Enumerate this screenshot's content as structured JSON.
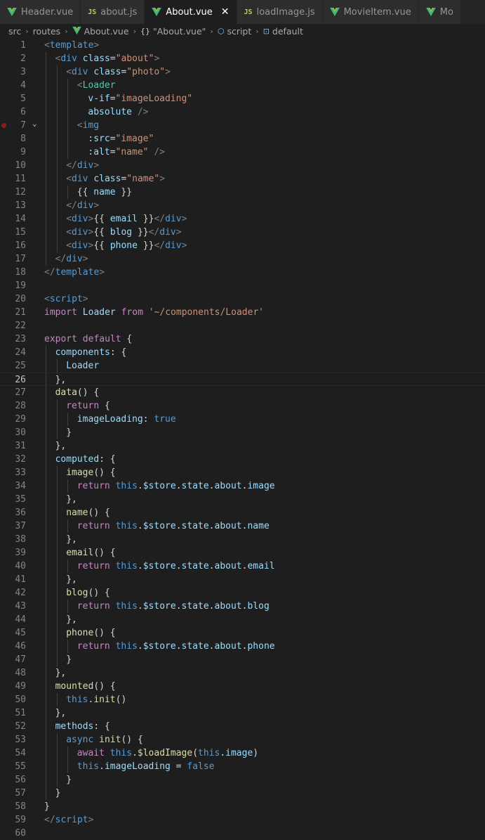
{
  "tabs": [
    {
      "label": "Header.vue",
      "icon": "vue-icon",
      "active": false
    },
    {
      "label": "about.js",
      "icon": "js-icon",
      "active": false
    },
    {
      "label": "About.vue",
      "icon": "vue-icon",
      "active": true
    },
    {
      "label": "loadImage.js",
      "icon": "js-icon",
      "active": false
    },
    {
      "label": "MovieItem.vue",
      "icon": "vue-icon",
      "active": false
    },
    {
      "label": "Mo",
      "icon": "vue-icon",
      "active": false
    }
  ],
  "tab_close_glyph": "✕",
  "breadcrumb": {
    "items": [
      "src",
      "routes",
      "About.vue",
      "\"About.vue\"",
      "script",
      "default"
    ],
    "icons": [
      "",
      "",
      "vue-icon",
      "braces-icon",
      "cube-icon",
      "symbol-icon"
    ],
    "braces_glyph": "{}",
    "separator": "›"
  },
  "editor": {
    "current_line": 26,
    "breakpoint_line": 7,
    "fold_line": 7,
    "lines": [
      {
        "n": "1",
        "indent": 0,
        "tokens": [
          [
            "<",
            "tg"
          ],
          [
            "template",
            "tn"
          ],
          [
            ">",
            "tg"
          ]
        ]
      },
      {
        "n": "2",
        "indent": 1,
        "tokens": [
          [
            "<",
            "tg"
          ],
          [
            "div",
            "tn"
          ],
          [
            " ",
            ""
          ],
          [
            "class",
            "at"
          ],
          [
            "=",
            "tx"
          ],
          [
            "\"about\"",
            "st"
          ],
          [
            ">",
            "tg"
          ]
        ]
      },
      {
        "n": "3",
        "indent": 2,
        "tokens": [
          [
            "<",
            "tg"
          ],
          [
            "div",
            "tn"
          ],
          [
            " ",
            ""
          ],
          [
            "class",
            "at"
          ],
          [
            "=",
            "tx"
          ],
          [
            "\"photo\"",
            "st"
          ],
          [
            ">",
            "tg"
          ]
        ]
      },
      {
        "n": "4",
        "indent": 3,
        "tokens": [
          [
            "<",
            "tg"
          ],
          [
            "Loader",
            "cm"
          ]
        ]
      },
      {
        "n": "5",
        "indent": 3,
        "extra": 1,
        "tokens": [
          [
            "v-if",
            "at"
          ],
          [
            "=",
            "tx"
          ],
          [
            "\"imageLoading\"",
            "st"
          ]
        ]
      },
      {
        "n": "6",
        "indent": 3,
        "extra": 1,
        "tokens": [
          [
            "absolute",
            "at"
          ],
          [
            " ",
            ""
          ],
          [
            "/>",
            "tg"
          ]
        ]
      },
      {
        "n": "7",
        "indent": 3,
        "tokens": [
          [
            "<",
            "tg"
          ],
          [
            "img",
            "tn"
          ]
        ]
      },
      {
        "n": "8",
        "indent": 3,
        "extra": 1,
        "tokens": [
          [
            ":src",
            "at"
          ],
          [
            "=",
            "tx"
          ],
          [
            "\"image\"",
            "st"
          ]
        ]
      },
      {
        "n": "9",
        "indent": 3,
        "extra": 1,
        "tokens": [
          [
            ":alt",
            "at"
          ],
          [
            "=",
            "tx"
          ],
          [
            "\"name\"",
            "st"
          ],
          [
            " ",
            ""
          ],
          [
            "/>",
            "tg"
          ]
        ]
      },
      {
        "n": "10",
        "indent": 2,
        "tokens": [
          [
            "</",
            "tg"
          ],
          [
            "div",
            "tn"
          ],
          [
            ">",
            "tg"
          ]
        ]
      },
      {
        "n": "11",
        "indent": 2,
        "tokens": [
          [
            "<",
            "tg"
          ],
          [
            "div",
            "tn"
          ],
          [
            " ",
            ""
          ],
          [
            "class",
            "at"
          ],
          [
            "=",
            "tx"
          ],
          [
            "\"name\"",
            "st"
          ],
          [
            ">",
            "tg"
          ]
        ]
      },
      {
        "n": "12",
        "indent": 3,
        "tokens": [
          [
            "{{ ",
            "tx"
          ],
          [
            "name",
            "pr"
          ],
          [
            " }}",
            "tx"
          ]
        ]
      },
      {
        "n": "13",
        "indent": 2,
        "tokens": [
          [
            "</",
            "tg"
          ],
          [
            "div",
            "tn"
          ],
          [
            ">",
            "tg"
          ]
        ]
      },
      {
        "n": "14",
        "indent": 2,
        "tokens": [
          [
            "<",
            "tg"
          ],
          [
            "div",
            "tn"
          ],
          [
            ">",
            "tg"
          ],
          [
            "{{ ",
            "tx"
          ],
          [
            "email",
            "pr"
          ],
          [
            " }}",
            "tx"
          ],
          [
            "</",
            "tg"
          ],
          [
            "div",
            "tn"
          ],
          [
            ">",
            "tg"
          ]
        ]
      },
      {
        "n": "15",
        "indent": 2,
        "tokens": [
          [
            "<",
            "tg"
          ],
          [
            "div",
            "tn"
          ],
          [
            ">",
            "tg"
          ],
          [
            "{{ ",
            "tx"
          ],
          [
            "blog",
            "pr"
          ],
          [
            " }}",
            "tx"
          ],
          [
            "</",
            "tg"
          ],
          [
            "div",
            "tn"
          ],
          [
            ">",
            "tg"
          ]
        ]
      },
      {
        "n": "16",
        "indent": 2,
        "tokens": [
          [
            "<",
            "tg"
          ],
          [
            "div",
            "tn"
          ],
          [
            ">",
            "tg"
          ],
          [
            "{{ ",
            "tx"
          ],
          [
            "phone",
            "pr"
          ],
          [
            " }}",
            "tx"
          ],
          [
            "</",
            "tg"
          ],
          [
            "div",
            "tn"
          ],
          [
            ">",
            "tg"
          ]
        ]
      },
      {
        "n": "17",
        "indent": 1,
        "tokens": [
          [
            "</",
            "tg"
          ],
          [
            "div",
            "tn"
          ],
          [
            ">",
            "tg"
          ]
        ]
      },
      {
        "n": "18",
        "indent": 0,
        "tokens": [
          [
            "</",
            "tg"
          ],
          [
            "template",
            "tn"
          ],
          [
            ">",
            "tg"
          ]
        ]
      },
      {
        "n": "19",
        "indent": 0,
        "tokens": []
      },
      {
        "n": "20",
        "indent": 0,
        "tokens": [
          [
            "<",
            "tg"
          ],
          [
            "script",
            "tn"
          ],
          [
            ">",
            "tg"
          ]
        ]
      },
      {
        "n": "21",
        "indent": 0,
        "tokens": [
          [
            "import",
            "kw"
          ],
          [
            " ",
            ""
          ],
          [
            "Loader",
            "pr"
          ],
          [
            " ",
            ""
          ],
          [
            "from",
            "kw"
          ],
          [
            " ",
            ""
          ],
          [
            "'~/components/Loader'",
            "st"
          ]
        ]
      },
      {
        "n": "22",
        "indent": 0,
        "tokens": []
      },
      {
        "n": "23",
        "indent": 0,
        "tokens": [
          [
            "export",
            "kw"
          ],
          [
            " ",
            ""
          ],
          [
            "default",
            "kw"
          ],
          [
            " {",
            "tx"
          ]
        ]
      },
      {
        "n": "24",
        "indent": 1,
        "tokens": [
          [
            "components",
            "pr"
          ],
          [
            ": {",
            "tx"
          ]
        ]
      },
      {
        "n": "25",
        "indent": 2,
        "tokens": [
          [
            "Loader",
            "pr"
          ]
        ]
      },
      {
        "n": "26",
        "indent": 1,
        "tokens": [
          [
            "},",
            "tx"
          ]
        ]
      },
      {
        "n": "27",
        "indent": 1,
        "tokens": [
          [
            "data",
            "fn"
          ],
          [
            "() {",
            "tx"
          ]
        ]
      },
      {
        "n": "28",
        "indent": 2,
        "tokens": [
          [
            "return",
            "kw"
          ],
          [
            " {",
            "tx"
          ]
        ]
      },
      {
        "n": "29",
        "indent": 3,
        "tokens": [
          [
            "imageLoading",
            "pr"
          ],
          [
            ": ",
            "tx"
          ],
          [
            "true",
            "bl"
          ]
        ]
      },
      {
        "n": "30",
        "indent": 2,
        "tokens": [
          [
            "}",
            "tx"
          ]
        ]
      },
      {
        "n": "31",
        "indent": 1,
        "tokens": [
          [
            "},",
            "tx"
          ]
        ]
      },
      {
        "n": "32",
        "indent": 1,
        "tokens": [
          [
            "computed",
            "pr"
          ],
          [
            ": {",
            "tx"
          ]
        ]
      },
      {
        "n": "33",
        "indent": 2,
        "tokens": [
          [
            "image",
            "fn"
          ],
          [
            "() {",
            "tx"
          ]
        ]
      },
      {
        "n": "34",
        "indent": 3,
        "tokens": [
          [
            "return",
            "kw"
          ],
          [
            " ",
            ""
          ],
          [
            "this",
            "bl"
          ],
          [
            ".",
            "tx"
          ],
          [
            "$store",
            "pr"
          ],
          [
            ".",
            "tx"
          ],
          [
            "state",
            "pr"
          ],
          [
            ".",
            "tx"
          ],
          [
            "about",
            "pr"
          ],
          [
            ".",
            "tx"
          ],
          [
            "image",
            "pr"
          ]
        ]
      },
      {
        "n": "35",
        "indent": 2,
        "tokens": [
          [
            "},",
            "tx"
          ]
        ]
      },
      {
        "n": "36",
        "indent": 2,
        "tokens": [
          [
            "name",
            "fn"
          ],
          [
            "() {",
            "tx"
          ]
        ]
      },
      {
        "n": "37",
        "indent": 3,
        "tokens": [
          [
            "return",
            "kw"
          ],
          [
            " ",
            ""
          ],
          [
            "this",
            "bl"
          ],
          [
            ".",
            "tx"
          ],
          [
            "$store",
            "pr"
          ],
          [
            ".",
            "tx"
          ],
          [
            "state",
            "pr"
          ],
          [
            ".",
            "tx"
          ],
          [
            "about",
            "pr"
          ],
          [
            ".",
            "tx"
          ],
          [
            "name",
            "pr"
          ]
        ]
      },
      {
        "n": "38",
        "indent": 2,
        "tokens": [
          [
            "},",
            "tx"
          ]
        ]
      },
      {
        "n": "39",
        "indent": 2,
        "tokens": [
          [
            "email",
            "fn"
          ],
          [
            "() {",
            "tx"
          ]
        ]
      },
      {
        "n": "40",
        "indent": 3,
        "tokens": [
          [
            "return",
            "kw"
          ],
          [
            " ",
            ""
          ],
          [
            "this",
            "bl"
          ],
          [
            ".",
            "tx"
          ],
          [
            "$store",
            "pr"
          ],
          [
            ".",
            "tx"
          ],
          [
            "state",
            "pr"
          ],
          [
            ".",
            "tx"
          ],
          [
            "about",
            "pr"
          ],
          [
            ".",
            "tx"
          ],
          [
            "email",
            "pr"
          ]
        ]
      },
      {
        "n": "41",
        "indent": 2,
        "tokens": [
          [
            "},",
            "tx"
          ]
        ]
      },
      {
        "n": "42",
        "indent": 2,
        "tokens": [
          [
            "blog",
            "fn"
          ],
          [
            "() {",
            "tx"
          ]
        ]
      },
      {
        "n": "43",
        "indent": 3,
        "tokens": [
          [
            "return",
            "kw"
          ],
          [
            " ",
            ""
          ],
          [
            "this",
            "bl"
          ],
          [
            ".",
            "tx"
          ],
          [
            "$store",
            "pr"
          ],
          [
            ".",
            "tx"
          ],
          [
            "state",
            "pr"
          ],
          [
            ".",
            "tx"
          ],
          [
            "about",
            "pr"
          ],
          [
            ".",
            "tx"
          ],
          [
            "blog",
            "pr"
          ]
        ]
      },
      {
        "n": "44",
        "indent": 2,
        "tokens": [
          [
            "},",
            "tx"
          ]
        ]
      },
      {
        "n": "45",
        "indent": 2,
        "tokens": [
          [
            "phone",
            "fn"
          ],
          [
            "() {",
            "tx"
          ]
        ]
      },
      {
        "n": "46",
        "indent": 3,
        "tokens": [
          [
            "return",
            "kw"
          ],
          [
            " ",
            ""
          ],
          [
            "this",
            "bl"
          ],
          [
            ".",
            "tx"
          ],
          [
            "$store",
            "pr"
          ],
          [
            ".",
            "tx"
          ],
          [
            "state",
            "pr"
          ],
          [
            ".",
            "tx"
          ],
          [
            "about",
            "pr"
          ],
          [
            ".",
            "tx"
          ],
          [
            "phone",
            "pr"
          ]
        ]
      },
      {
        "n": "47",
        "indent": 2,
        "tokens": [
          [
            "}",
            "tx"
          ]
        ]
      },
      {
        "n": "48",
        "indent": 1,
        "tokens": [
          [
            "},",
            "tx"
          ]
        ]
      },
      {
        "n": "49",
        "indent": 1,
        "tokens": [
          [
            "mounted",
            "fn"
          ],
          [
            "() {",
            "tx"
          ]
        ]
      },
      {
        "n": "50",
        "indent": 2,
        "tokens": [
          [
            "this",
            "bl"
          ],
          [
            ".",
            "tx"
          ],
          [
            "init",
            "fn"
          ],
          [
            "()",
            "tx"
          ]
        ]
      },
      {
        "n": "51",
        "indent": 1,
        "tokens": [
          [
            "},",
            "tx"
          ]
        ]
      },
      {
        "n": "52",
        "indent": 1,
        "tokens": [
          [
            "methods",
            "pr"
          ],
          [
            ": {",
            "tx"
          ]
        ]
      },
      {
        "n": "53",
        "indent": 2,
        "tokens": [
          [
            "async",
            "bl"
          ],
          [
            " ",
            ""
          ],
          [
            "init",
            "fn"
          ],
          [
            "() {",
            "tx"
          ]
        ]
      },
      {
        "n": "54",
        "indent": 3,
        "tokens": [
          [
            "await",
            "kw"
          ],
          [
            " ",
            ""
          ],
          [
            "this",
            "bl"
          ],
          [
            ".",
            "tx"
          ],
          [
            "$loadImage",
            "fn"
          ],
          [
            "(",
            "tx"
          ],
          [
            "this",
            "bl"
          ],
          [
            ".",
            "tx"
          ],
          [
            "image",
            "pr"
          ],
          [
            ")",
            "tx"
          ]
        ]
      },
      {
        "n": "55",
        "indent": 3,
        "tokens": [
          [
            "this",
            "bl"
          ],
          [
            ".",
            "tx"
          ],
          [
            "imageLoading",
            "pr"
          ],
          [
            " = ",
            "tx"
          ],
          [
            "false",
            "bl"
          ]
        ]
      },
      {
        "n": "56",
        "indent": 2,
        "tokens": [
          [
            "}",
            "tx"
          ]
        ]
      },
      {
        "n": "57",
        "indent": 1,
        "tokens": [
          [
            "}",
            "tx"
          ]
        ]
      },
      {
        "n": "58",
        "indent": 0,
        "tokens": [
          [
            "}",
            "tx"
          ]
        ]
      },
      {
        "n": "59",
        "indent": 0,
        "tokens": [
          [
            "</",
            "tg"
          ],
          [
            "script",
            "tn"
          ],
          [
            ">",
            "tg"
          ]
        ]
      },
      {
        "n": "60",
        "indent": 0,
        "tokens": []
      }
    ]
  }
}
